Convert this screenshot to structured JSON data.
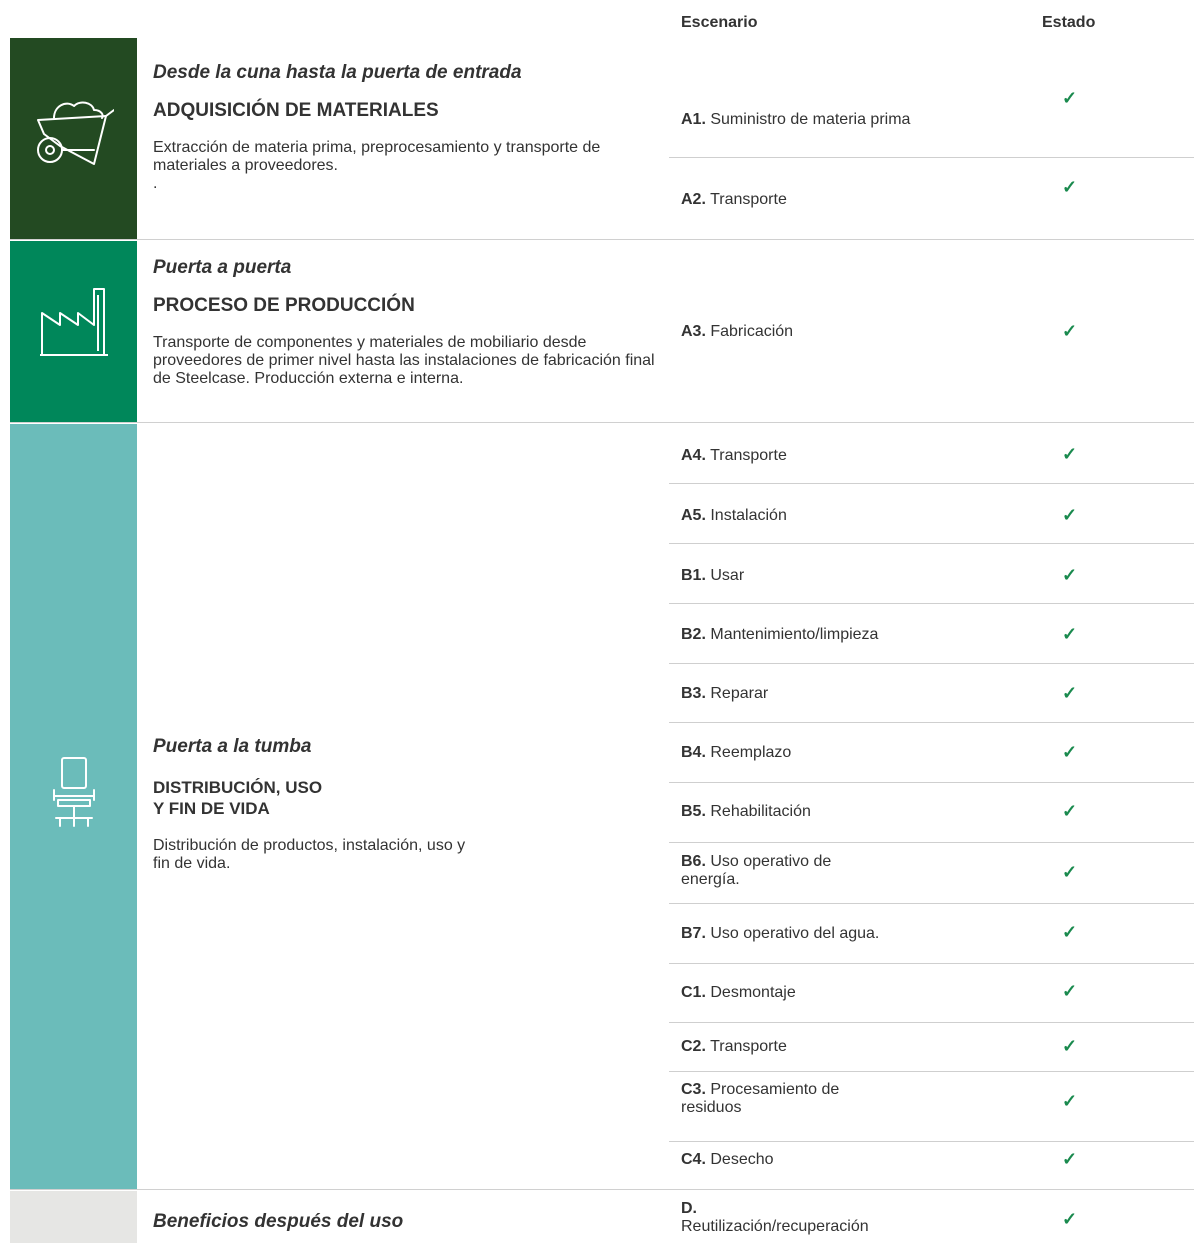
{
  "header": {
    "scenario": "Escenario",
    "status": "Estado"
  },
  "colors": {
    "stage1": "#234a22",
    "stage2": "#00875a",
    "stage3": "#6bbcba",
    "stage4": "#e6e6e4",
    "check": "#1a8a4e"
  },
  "stages": [
    {
      "subtitle": "Desde la cuna hasta la puerta de entrada",
      "title": "ADQUISICIÓN DE MATERIALES",
      "description": "Extracción de materia prima, preprocesamiento y transporte de materiales a proveedores.\n.",
      "icon": "wheelbarrow-icon"
    },
    {
      "subtitle": "Puerta a puerta",
      "title": "PROCESO DE PRODUCCIÓN",
      "description": "Transporte de componentes y materiales de mobiliario desde proveedores de primer nivel hasta las instalaciones de fabricación final de Steelcase. Producción externa e interna.",
      "icon": "factory-icon"
    },
    {
      "subtitle": "Puerta a la tumba",
      "title": "DISTRIBUCIÓN, USO\nY FIN DE VIDA",
      "description": "Distribución de productos, instalación, uso y\nfin de vida.",
      "icon": "office-chair-icon"
    },
    {
      "subtitle": "Beneficios después del uso",
      "title": "",
      "description": "",
      "icon": ""
    }
  ],
  "rows": [
    {
      "code": "A1.",
      "label": "Suministro de materia prima",
      "status": "✓"
    },
    {
      "code": "A2.",
      "label": "Transporte",
      "status": "✓"
    },
    {
      "code": "A3.",
      "label": "Fabricación",
      "status": "✓"
    },
    {
      "code": "A4.",
      "label": "Transporte",
      "status": "✓"
    },
    {
      "code": "A5.",
      "label": "Instalación",
      "status": "✓"
    },
    {
      "code": "B1.",
      "label": "Usar",
      "status": "✓"
    },
    {
      "code": "B2.",
      "label": "Mantenimiento/limpieza",
      "status": "✓"
    },
    {
      "code": "B3.",
      "label": "Reparar",
      "status": "✓"
    },
    {
      "code": "B4.",
      "label": "Reemplazo",
      "status": "✓"
    },
    {
      "code": "B5.",
      "label": "Rehabilitación",
      "status": "✓"
    },
    {
      "code": "B6.",
      "label": "Uso operativo de energía.",
      "status": "✓"
    },
    {
      "code": "B7.",
      "label": "Uso operativo del agua.",
      "status": "✓"
    },
    {
      "code": "C1.",
      "label": "Desmontaje",
      "status": "✓"
    },
    {
      "code": "C2.",
      "label": "Transporte",
      "status": "✓"
    },
    {
      "code": "C3.",
      "label": "Procesamiento de residuos",
      "status": "✓"
    },
    {
      "code": "C4.",
      "label": "Desecho",
      "status": "✓"
    },
    {
      "code": "D.",
      "label": "Reutilización/recuperación",
      "status": "✓"
    }
  ]
}
